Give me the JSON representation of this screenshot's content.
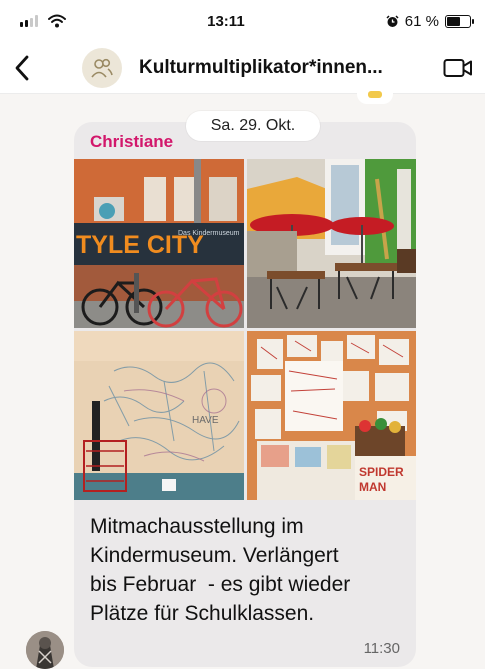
{
  "status_bar": {
    "time": "13:11",
    "battery_percent": "61 %",
    "battery_level": 0.61,
    "signal_bars": 2,
    "icons": [
      "signal-icon",
      "wifi-icon",
      "alarm-icon",
      "battery-icon"
    ]
  },
  "header": {
    "title": "Kulturmultiplikator*innen...",
    "icons": [
      "back-icon",
      "group-avatar-icon",
      "video-call-icon"
    ]
  },
  "date_separator": "Sa. 29. Okt.",
  "message": {
    "sender": "Christiane",
    "sender_color": "#d2176b",
    "text_lines": [
      "Mitmachausstellung im",
      "Kindermuseum. Verlängert",
      "bis Februar  - es gibt wieder",
      "Plätze für Schulklassen."
    ],
    "time": "11:30",
    "photos": [
      {
        "name": "photo-street-bikes",
        "sign_text": "TYLE CITY",
        "sign_text_2": "Das Kindermuseum"
      },
      {
        "name": "photo-cafe-umbrellas"
      },
      {
        "name": "photo-drawn-wall",
        "wall_text": "HAVE"
      },
      {
        "name": "photo-paper-wall",
        "wall_text": "SPIDER",
        "wall_text_2": "MAN"
      }
    ]
  },
  "colors": {
    "bubble": "#ebe9ea",
    "background": "#f7f5f3",
    "accent": "#d2176b"
  }
}
